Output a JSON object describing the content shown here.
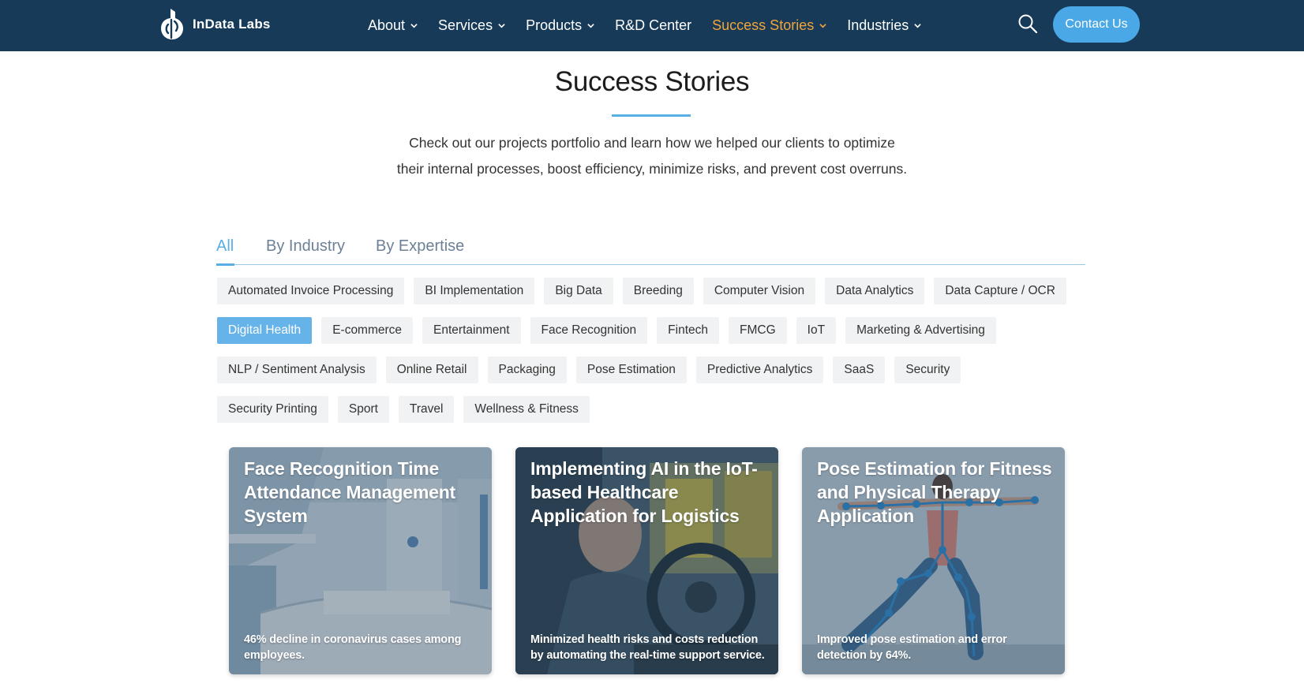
{
  "header": {
    "logo_text": "InData Labs",
    "nav": [
      {
        "label": "About",
        "has_dropdown": true
      },
      {
        "label": "Services",
        "has_dropdown": true
      },
      {
        "label": "Products",
        "has_dropdown": true
      },
      {
        "label": "R&D Center",
        "has_dropdown": false
      },
      {
        "label": "Success Stories",
        "has_dropdown": true,
        "active": true
      },
      {
        "label": "Industries",
        "has_dropdown": true
      }
    ],
    "search_icon": "search-icon",
    "contact_label": "Contact Us"
  },
  "hero": {
    "title": "Success Stories",
    "intro_line1": "Check out our projects portfolio and learn how we helped our clients to optimize",
    "intro_line2": "their internal processes, boost efficiency, minimize risks, and prevent cost overruns."
  },
  "tabs": [
    {
      "label": "All",
      "active": true
    },
    {
      "label": "By Industry",
      "active": false
    },
    {
      "label": "By Expertise",
      "active": false
    }
  ],
  "tags": [
    {
      "label": "Automated Invoice Processing"
    },
    {
      "label": "BI Implementation"
    },
    {
      "label": "Big Data"
    },
    {
      "label": "Breeding"
    },
    {
      "label": "Computer Vision"
    },
    {
      "label": "Data Analytics"
    },
    {
      "label": "Data Capture / OCR"
    },
    {
      "label": "Digital Health",
      "active": true
    },
    {
      "label": "E-commerce"
    },
    {
      "label": "Entertainment"
    },
    {
      "label": "Face Recognition"
    },
    {
      "label": "Fintech"
    },
    {
      "label": "FMCG"
    },
    {
      "label": "IoT"
    },
    {
      "label": "Marketing & Advertising"
    },
    {
      "label": "NLP / Sentiment Analysis"
    },
    {
      "label": "Online Retail"
    },
    {
      "label": "Packaging"
    },
    {
      "label": "Pose Estimation"
    },
    {
      "label": "Predictive Analytics"
    },
    {
      "label": "SaaS"
    },
    {
      "label": "Security"
    },
    {
      "label": "Security Printing"
    },
    {
      "label": "Sport"
    },
    {
      "label": "Travel"
    },
    {
      "label": "Wellness & Fitness"
    }
  ],
  "cards": [
    {
      "title": "Face Recognition Time Attendance Management System",
      "subtitle": "46% decline in coronavirus cases among employees."
    },
    {
      "title": "Implementing AI in the IoT-based Healthcare Application for Logistics",
      "subtitle": "Minimized health risks and costs reduction by automating the real-time support service."
    },
    {
      "title": "Pose Estimation for Fitness and Physical Therapy Application",
      "subtitle": "Improved pose estimation and error detection by 64%."
    }
  ],
  "colors": {
    "header_bg": "#163a57",
    "accent": "#5aaee6",
    "nav_active": "#f3a43a",
    "contact_button": "#4aa8e6"
  }
}
